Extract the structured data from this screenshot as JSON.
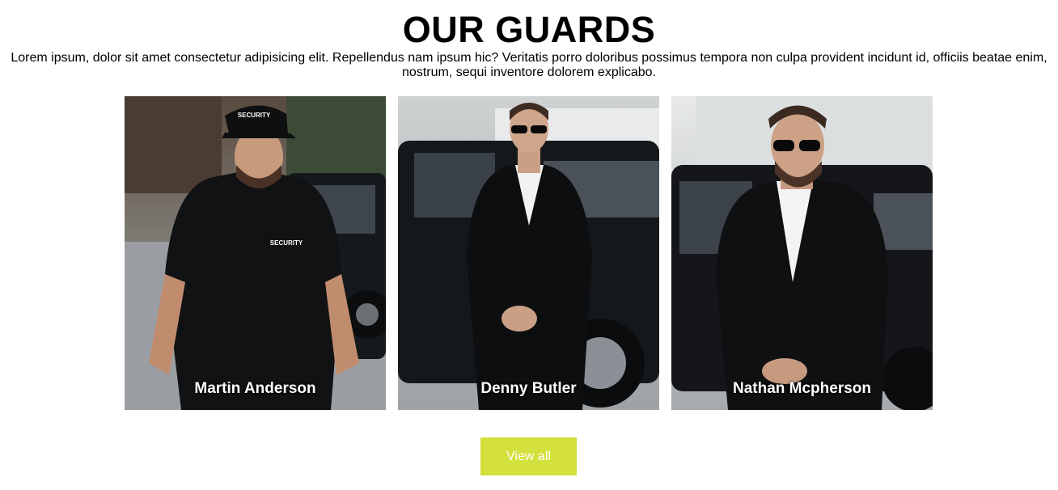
{
  "section": {
    "title": "OUR GUARDS",
    "intro": "Lorem ipsum, dolor sit amet consectetur adipisicing elit. Repellendus nam ipsum hic? Veritatis porro doloribus possimus tempora non culpa provident incidunt id, officiis beatae enim, nostrum, sequi inventore dolorem explicabo."
  },
  "guards": [
    {
      "name": "Martin Anderson",
      "cap_text": "SECURITY",
      "shirt_text": "SECURITY"
    },
    {
      "name": "Denny Butler"
    },
    {
      "name": "Nathan Mcpherson"
    }
  ],
  "actions": {
    "view_all_label": "View all"
  },
  "colors": {
    "accent": "#d4e03c",
    "background": "#ffffff"
  }
}
